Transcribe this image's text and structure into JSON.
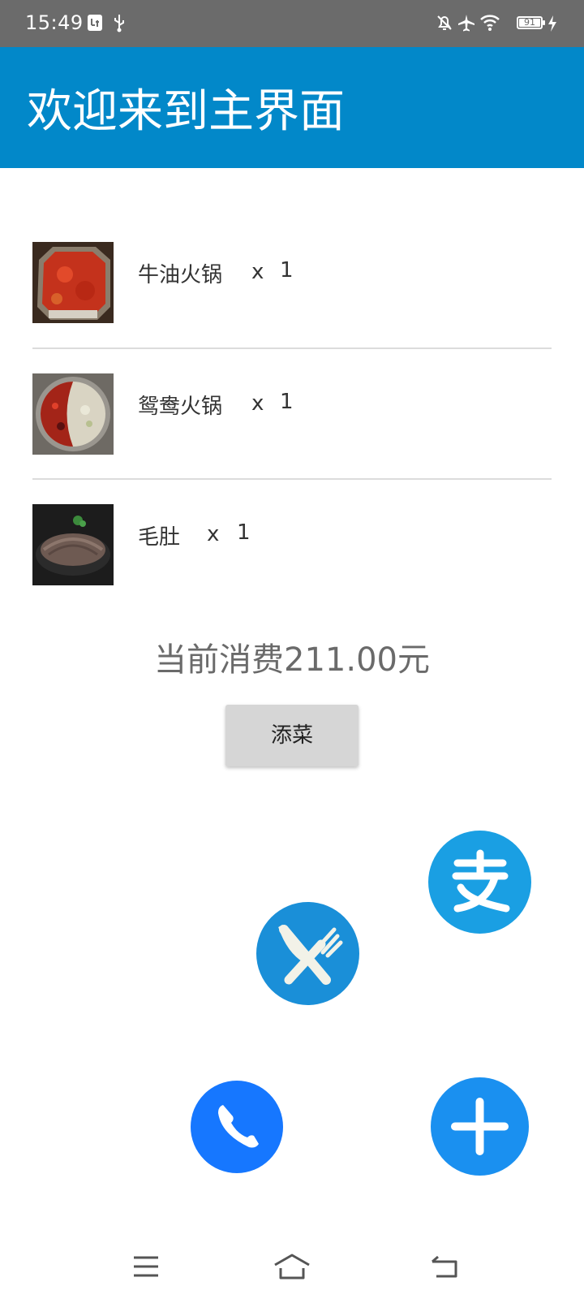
{
  "status_bar": {
    "time": "15:49",
    "battery": "91",
    "icons": [
      "usb-debug-icon",
      "usb-icon",
      "mute-icon",
      "airplane-icon",
      "wifi-icon",
      "battery-icon",
      "charging-icon"
    ]
  },
  "app_bar": {
    "title": "欢迎来到主界面"
  },
  "orders": [
    {
      "name": "牛油火锅",
      "x": "x",
      "qty": "1"
    },
    {
      "name": "鸳鸯火锅",
      "x": "x",
      "qty": "1"
    },
    {
      "name": "毛肚",
      "x": "x",
      "qty": "1"
    }
  ],
  "total": {
    "text": "当前消费211.00元"
  },
  "add_dish_button": {
    "label": "添菜"
  },
  "fab_icons": {
    "alipay": {
      "glyph": "支",
      "color": "#1a9fe3"
    },
    "menu": {
      "icon": "knife-fork-icon",
      "color": "#1a8fd8"
    },
    "call": {
      "icon": "phone-icon",
      "color": "#1677ff"
    },
    "add": {
      "icon": "plus-icon",
      "color": "#1a90f0"
    }
  },
  "nav_bar": {
    "icons": [
      "menu-icon",
      "home-icon",
      "back-icon"
    ]
  }
}
